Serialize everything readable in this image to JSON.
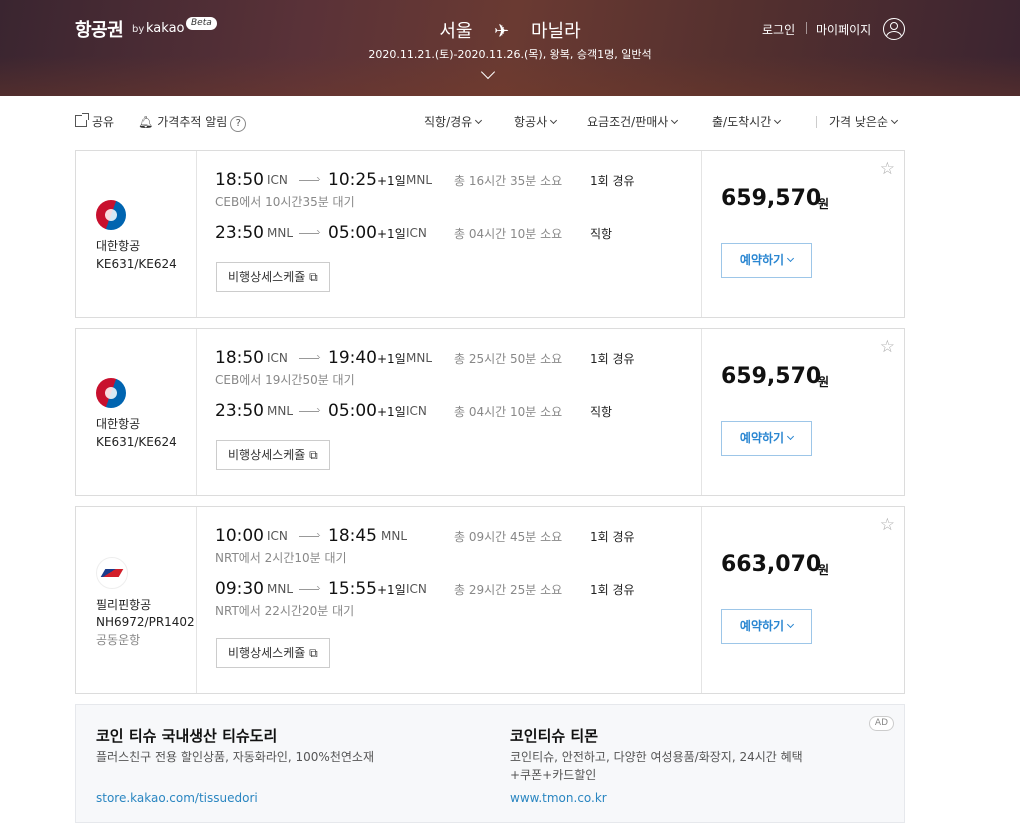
{
  "header": {
    "brand": "항공권",
    "brand_by": "by",
    "brand_kakao": "kakao",
    "brand_beta": "Beta",
    "origin": "서울",
    "plane_glyph": "✈",
    "destination": "마닐라",
    "trip_summary": "2020.11.21.(토)-2020.11.26.(목), 왕복, 승객1명, 일반석",
    "login": "로그인",
    "mypage": "마이페이지"
  },
  "toolbar": {
    "share": "공유",
    "price_alert": "가격추적 알림",
    "help": "?",
    "filters": [
      "직항/경유",
      "항공사",
      "요금조건/판매사",
      "출/도착시간"
    ],
    "sort": "가격 낮은순"
  },
  "results": [
    {
      "airline": "대한항공",
      "codes": "KE631/KE624",
      "note": "",
      "logo": "korean-air-logo",
      "legs": [
        {
          "dep_time": "18:50",
          "dep_ap": "ICN",
          "arr_time": "10:25",
          "plus": "+1일",
          "arr_ap": "MNL",
          "duration": "총 16시간 35분 소요",
          "stops": "1회 경유",
          "wait": "CEB에서 10시간35분 대기"
        },
        {
          "dep_time": "23:50",
          "dep_ap": "MNL",
          "arr_time": "05:00",
          "plus": "+1일",
          "arr_ap": "ICN",
          "duration": "총 04시간 10분 소요",
          "stops": "직항",
          "wait": ""
        }
      ],
      "detail": "비행상세스케쥴",
      "price": "659,570",
      "currency": "원",
      "book": "예약하기"
    },
    {
      "airline": "대한항공",
      "codes": "KE631/KE624",
      "note": "",
      "logo": "korean-air-logo",
      "legs": [
        {
          "dep_time": "18:50",
          "dep_ap": "ICN",
          "arr_time": "19:40",
          "plus": "+1일",
          "arr_ap": "MNL",
          "duration": "총 25시간 50분 소요",
          "stops": "1회 경유",
          "wait": "CEB에서 19시간50분 대기"
        },
        {
          "dep_time": "23:50",
          "dep_ap": "MNL",
          "arr_time": "05:00",
          "plus": "+1일",
          "arr_ap": "ICN",
          "duration": "총 04시간 10분 소요",
          "stops": "직항",
          "wait": ""
        }
      ],
      "detail": "비행상세스케쥴",
      "price": "659,570",
      "currency": "원",
      "book": "예약하기"
    },
    {
      "airline": "필리핀항공",
      "codes": "NH6972/PR1402",
      "note": "공동운항",
      "logo": "philippine-airlines-logo",
      "legs": [
        {
          "dep_time": "10:00",
          "dep_ap": "ICN",
          "arr_time": "18:45",
          "plus": "",
          "arr_ap": "MNL",
          "duration": "총 09시간 45분 소요",
          "stops": "1회 경유",
          "wait": "NRT에서 2시간10분 대기"
        },
        {
          "dep_time": "09:30",
          "dep_ap": "MNL",
          "arr_time": "15:55",
          "plus": "+1일",
          "arr_ap": "ICN",
          "duration": "총 29시간 25분 소요",
          "stops": "1회 경유",
          "wait": "NRT에서 22시간20분 대기"
        }
      ],
      "detail": "비행상세스케쥴",
      "price": "663,070",
      "currency": "원",
      "book": "예약하기"
    }
  ],
  "ad": {
    "badge": "AD",
    "items": [
      {
        "title": "코인 티슈 국내생산 티슈도리",
        "desc": "플러스친구 전용 할인상품, 자동화라인, 100%천연소재",
        "url": "store.kakao.com/tissuedori"
      },
      {
        "title": "코인티슈 티몬",
        "desc": "코인티슈, 안전하고, 다양한 여성용품/화장지, 24시간 혜택 +쿠폰+카드할인",
        "url": "www.tmon.co.kr"
      }
    ]
  }
}
